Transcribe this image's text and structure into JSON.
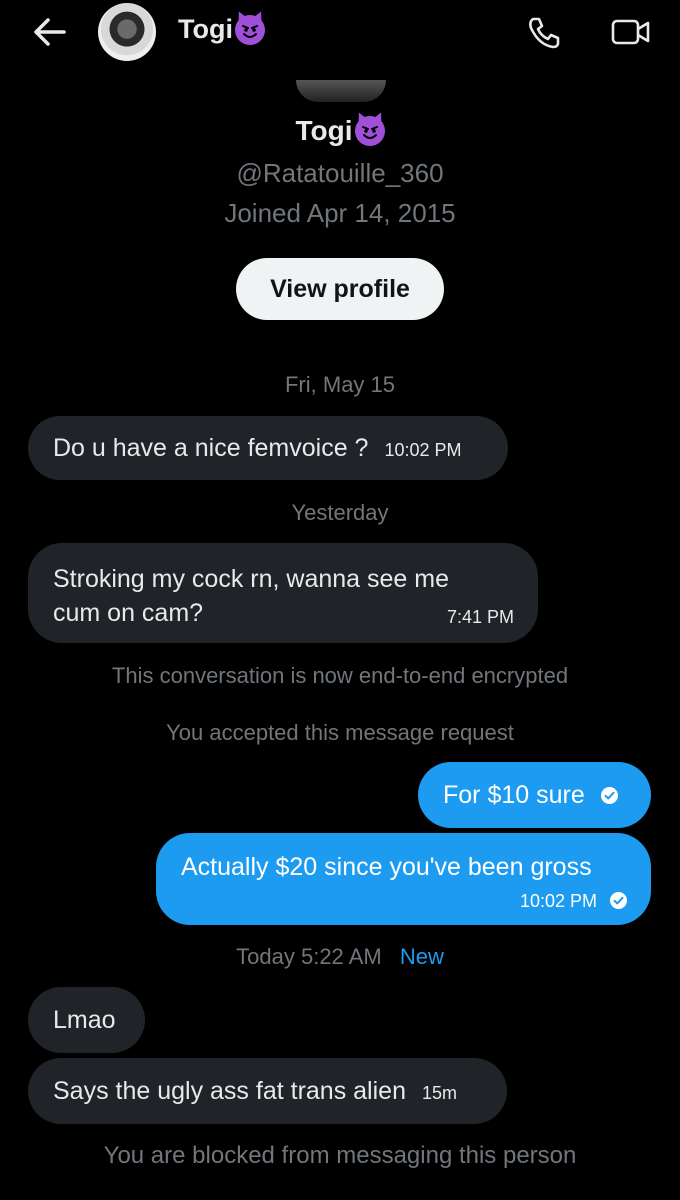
{
  "header": {
    "name": "Togi",
    "emoji": "smiling-face-with-horns"
  },
  "profile": {
    "name": "Togi",
    "handle": "@Ratatouille_360",
    "joined": "Joined Apr 14, 2015",
    "view_profile_label": "View profile"
  },
  "messages": {
    "date_1": "Fri, May 15",
    "msg_1_text": "Do u have a nice femvoice ?",
    "msg_1_time": "10:02 PM",
    "date_2": "Yesterday",
    "msg_2_text_line1": "Stroking my cock rn, wanna see me",
    "msg_2_text_line2": "cum on cam?",
    "msg_2_time": "7:41 PM",
    "system_1": "This conversation is now end-to-end encrypted",
    "system_2": "You accepted this message request",
    "out_1_text": "For $10 sure",
    "out_2_text": "Actually $20 since you've been gross",
    "out_2_time": "10:02 PM",
    "date_3": "Today 5:22 AM",
    "new_label": "New",
    "msg_3_text": "Lmao",
    "msg_4_text": "Says the ugly ass fat trans alien",
    "msg_4_time": "15m",
    "blocked_notice": "You are blocked from messaging this person"
  },
  "colors": {
    "background": "#000000",
    "incoming_bubble": "#202327",
    "outgoing_bubble": "#1d9bf0",
    "muted_text": "#71767b",
    "accent": "#1d9bf0"
  }
}
